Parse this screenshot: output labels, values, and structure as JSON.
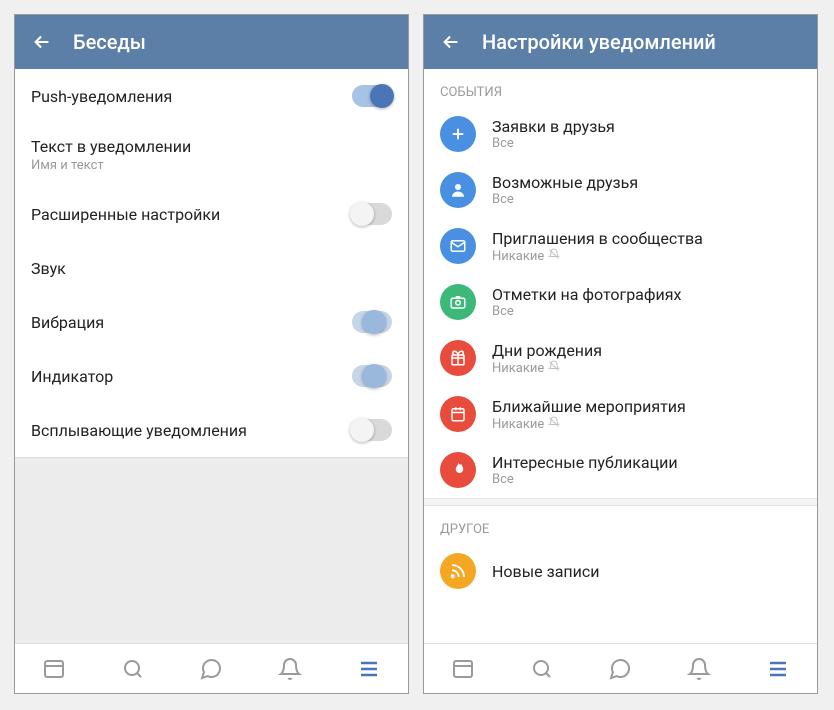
{
  "left": {
    "title": "Беседы",
    "rows": [
      {
        "label": "Push-уведомления",
        "sub": "",
        "toggle": "on"
      },
      {
        "label": "Текст в уведомлении",
        "sub": "Имя и текст",
        "toggle": ""
      },
      {
        "label": "Расширенные настройки",
        "sub": "",
        "toggle": "off"
      },
      {
        "label": "Звук",
        "sub": "",
        "toggle": ""
      },
      {
        "label": "Вибрация",
        "sub": "",
        "toggle": "partial"
      },
      {
        "label": "Индикатор",
        "sub": "",
        "toggle": "partial"
      },
      {
        "label": "Всплывающие уведомления",
        "sub": "",
        "toggle": "off"
      }
    ]
  },
  "right": {
    "title": "Настройки уведомлений",
    "section1": "СОБЫТИЯ",
    "events": [
      {
        "icon": "plus",
        "color": "#4a90e2",
        "label": "Заявки в друзья",
        "sub": "Все",
        "muted": false
      },
      {
        "icon": "user",
        "color": "#4a90e2",
        "label": "Возможные друзья",
        "sub": "Все",
        "muted": false
      },
      {
        "icon": "mail",
        "color": "#4a90e2",
        "label": "Приглашения в сообщества",
        "sub": "Никакие",
        "muted": true
      },
      {
        "icon": "camera",
        "color": "#3cb878",
        "label": "Отметки на фотографиях",
        "sub": "Все",
        "muted": false
      },
      {
        "icon": "gift",
        "color": "#e74c3c",
        "label": "Дни рождения",
        "sub": "Никакие",
        "muted": true
      },
      {
        "icon": "calendar",
        "color": "#e74c3c",
        "label": "Ближайшие мероприятия",
        "sub": "Никакие",
        "muted": true
      },
      {
        "icon": "fire",
        "color": "#e74c3c",
        "label": "Интересные публикации",
        "sub": "Все",
        "muted": false
      }
    ],
    "section2": "ДРУГОЕ",
    "other": [
      {
        "icon": "rss",
        "color": "#f5a623",
        "label": "Новые записи",
        "sub": "",
        "muted": false
      }
    ]
  },
  "colors": {
    "accent": "#4a76b8",
    "header": "#5b7fa6"
  }
}
